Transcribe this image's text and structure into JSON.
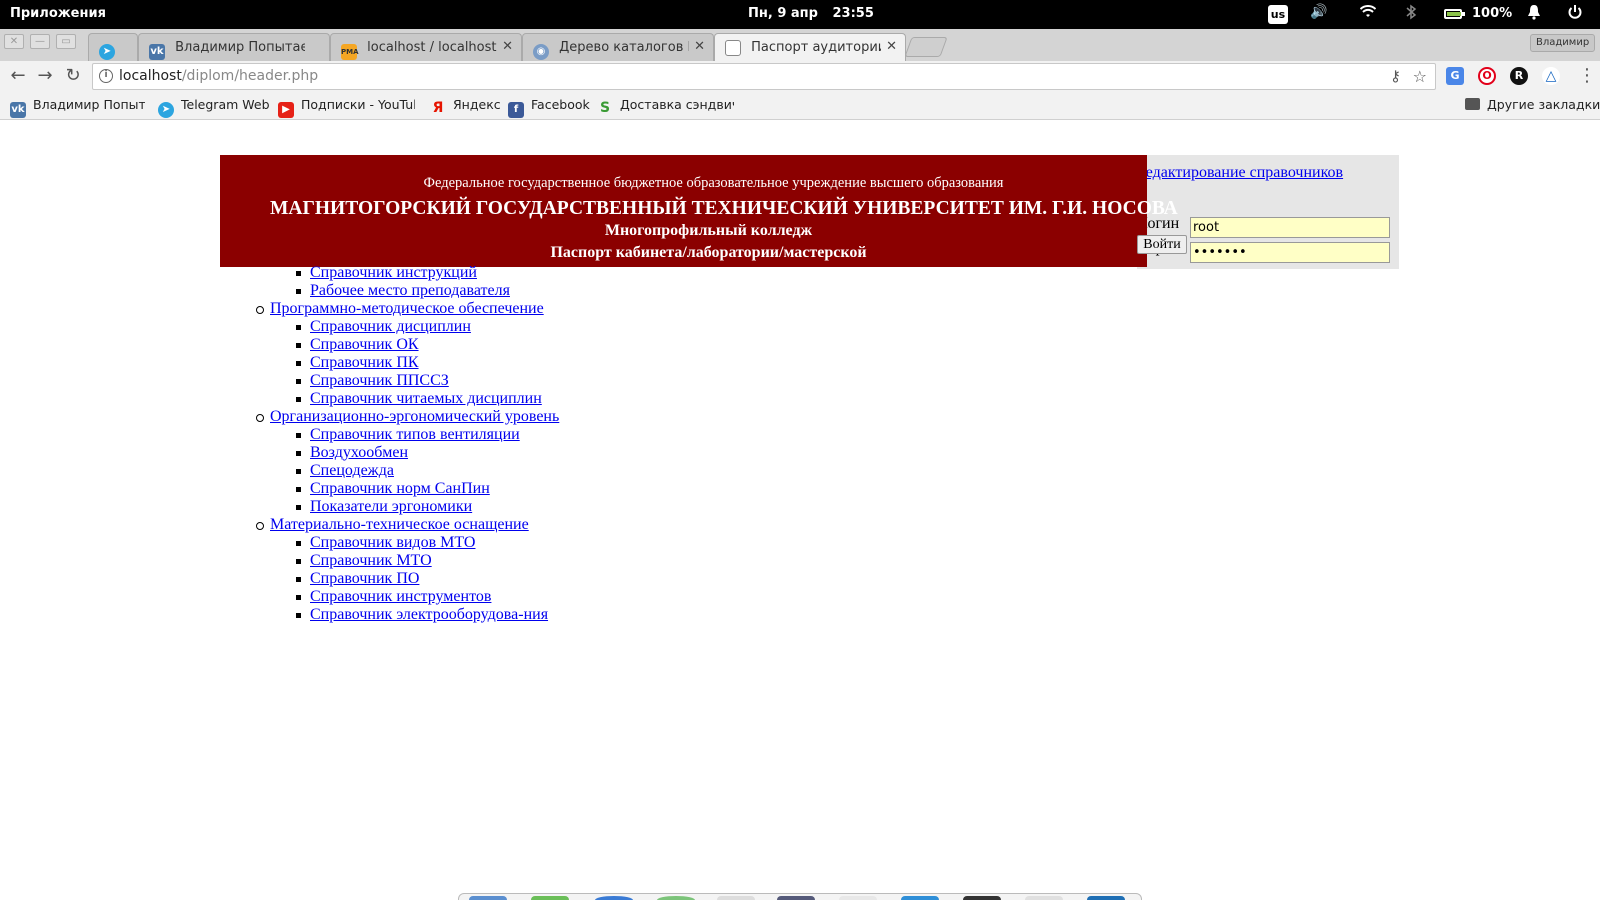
{
  "system_bar": {
    "apps_label": "Приложения",
    "date": "Пн, 9 апр",
    "time": "23:55",
    "keyboard_layout": "us",
    "battery_percent": "100%",
    "battery_level": 1.0
  },
  "tabs": [
    {
      "title": "",
      "icon": "telegram-icon",
      "active": false
    },
    {
      "title": "Владимир Попытаев",
      "icon": "vk-icon",
      "active": false
    },
    {
      "title": "localhost / localhost / ph",
      "icon": "phpmyadmin-icon",
      "active": false
    },
    {
      "title": "Дерево каталогов NES",
      "icon": "globe-icon",
      "active": false
    },
    {
      "title": "Паспорт аудитории",
      "icon": "page-icon",
      "active": true
    }
  ],
  "profile_name": "Владимир",
  "address_bar": {
    "host": "localhost",
    "path": "/diplom/header.php"
  },
  "bookmarks": [
    {
      "label": "Владимир Попытае",
      "icon": "vk-icon"
    },
    {
      "label": "Telegram Web",
      "icon": "telegram-icon"
    },
    {
      "label": "Подписки - YouTub",
      "icon": "youtube-icon"
    },
    {
      "label": "Яндекс",
      "icon": "yandex-icon"
    },
    {
      "label": "Facebook",
      "icon": "facebook-icon"
    },
    {
      "label": "Доставка сэндвиче",
      "icon": "subway-icon"
    }
  ],
  "other_bookmarks": "Другие закладки",
  "login": {
    "edit_link": "Редактирование справочников",
    "login_label": "Логин",
    "login_value": "root",
    "password_label": "Пароль",
    "password_value": "•••••••",
    "submit_label": "Войти"
  },
  "header": {
    "organization": "Федеральное государственное бюджетное образовательное учреждение высшего образования",
    "university": "МАГНИТОГОРСКИЙ ГОСУДАРСТВЕННЫЙ ТЕХНИЧЕСКИЙ УНИВЕРСИТЕТ ИМ. Г.И. НОСОВА",
    "college": "Многопрофильный колледж",
    "passport": "Паспорт кабинета/лаборатории/мастерской"
  },
  "menu": {
    "top_items": [
      "Справочник инструкций",
      "Рабочее место преподавателя"
    ],
    "sections": [
      {
        "title": "Программно-методическое обеспечение",
        "items": [
          "Справочник дисциплин",
          "Справочник ОК",
          "Справочник ПК",
          "Справочник ППССЗ",
          "Справочник читаемых дисциплин"
        ]
      },
      {
        "title": "Организационно-эргономический уровень",
        "items": [
          "Справочник типов вентиляции",
          "Воздухообмен",
          "Спецодежда",
          "Справочник норм СанПин",
          "Показатели эргономики"
        ]
      },
      {
        "title": "Материально-техническое оснащение",
        "items": [
          "Справочник видов МТО",
          "Справочник МТО",
          "Справочник ПО",
          "Справочник инструментов",
          "Справочник электрооборудова-ния"
        ]
      }
    ]
  },
  "colors": {
    "header_bg": "#8b0000",
    "link": "#0000ee",
    "login_bg": "#e6e6e6",
    "input_bg": "#ffffc6"
  }
}
